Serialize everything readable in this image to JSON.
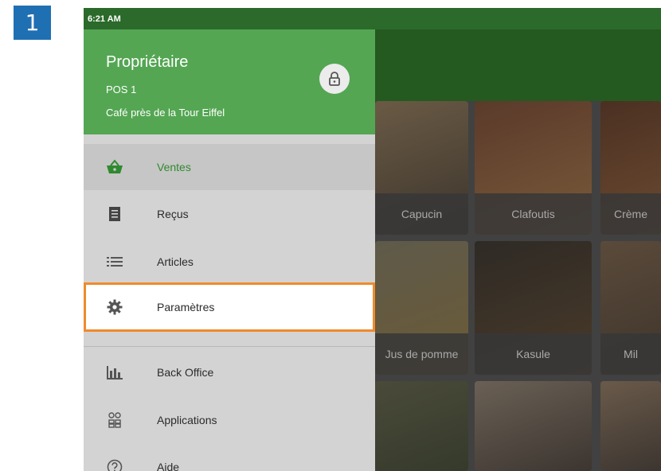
{
  "step": "1",
  "status_bar": {
    "time": "6:21 AM"
  },
  "drawer": {
    "owner": "Propriétaire",
    "pos": "POS 1",
    "store": "Café près de la Tour Eiffel",
    "lock_icon": "lock-icon",
    "items": [
      {
        "label": "Ventes",
        "icon": "basket-icon",
        "active": true
      },
      {
        "label": "Reçus",
        "icon": "receipt-icon"
      },
      {
        "label": "Articles",
        "icon": "list-icon"
      },
      {
        "label": "Paramètres",
        "icon": "gear-icon",
        "highlighted": true
      },
      {
        "label": "Back Office",
        "icon": "bar-chart-icon"
      },
      {
        "label": "Applications",
        "icon": "apps-icon"
      },
      {
        "label": "Aide",
        "icon": "help-icon"
      }
    ]
  },
  "products": [
    {
      "name": "Capucin"
    },
    {
      "name": "Clafoutis"
    },
    {
      "name": "Crème"
    },
    {
      "name": "Jus de pomme"
    },
    {
      "name": "Kasule"
    },
    {
      "name": "Mil"
    }
  ],
  "colors": {
    "accent": "#54a653",
    "highlight": "#f08a2c",
    "badge": "#1f6fb3"
  }
}
